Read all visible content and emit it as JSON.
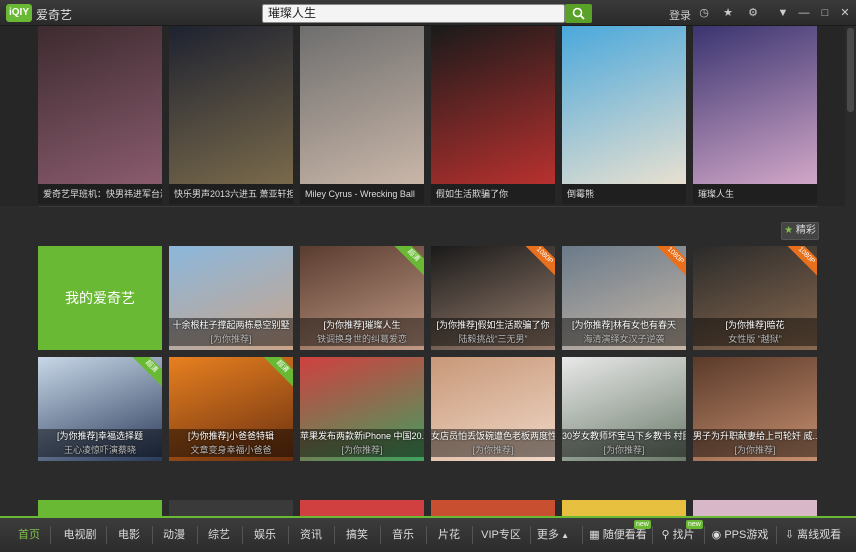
{
  "titlebar": {
    "logo": "iQIY",
    "app_name": "爱奇艺",
    "search_value": "璀璨人生",
    "login_label": "登录",
    "icons": [
      "history-icon",
      "favorite-icon",
      "skin-icon",
      "menu-icon",
      "minimize-icon",
      "maximize-icon",
      "close-icon"
    ]
  },
  "banner": [
    {
      "caption": "爱奇艺早班机：快男祎进军台湾",
      "colors": [
        "#3d2b2f",
        "#8a5b6e"
      ]
    },
    {
      "caption": "快乐男声2013六进五 萧亚轩担",
      "colors": [
        "#1e2230",
        "#7a6a4b"
      ]
    },
    {
      "caption": "Miley Cyrus - Wrecking Ball",
      "colors": [
        "#6e6e6e",
        "#c9b6a8"
      ]
    },
    {
      "caption": "假如生活欺骗了你",
      "colors": [
        "#1a1a1a",
        "#b8312f"
      ]
    },
    {
      "caption": "倒霉熊",
      "colors": [
        "#4aa8dc",
        "#e8e0d0"
      ]
    },
    {
      "caption": "璀璨人生",
      "colors": [
        "#3a3470",
        "#d2a7c8"
      ]
    }
  ],
  "jingcai_label": "精彩",
  "my_iqiyi": "我的爱奇艺",
  "row1": [
    {
      "t1": "十余根柱子撑起两栋悬空别墅",
      "t2": "[为你推荐]",
      "badge": "",
      "colors": [
        "#8bb7dc",
        "#c9a48a"
      ]
    },
    {
      "t1": "[为你推荐]璀璨人生",
      "t2": "铁调换身世的纠葛爱恋",
      "badge": "超清",
      "colors": [
        "#5a3c30",
        "#c09a85"
      ]
    },
    {
      "t1": "[为你推荐]假如生活欺骗了你",
      "t2": "陆毅挑战“三无男”",
      "badge": "1080P",
      "colors": [
        "#1a1a1a",
        "#9a8070"
      ]
    },
    {
      "t1": "[为你推荐]林有女也有春天",
      "t2": "海清演绎女汉子逆袭",
      "badge": "1080P",
      "colors": [
        "#6a7a8a",
        "#c8b8a8"
      ]
    },
    {
      "t1": "[为你推荐]暗花",
      "t2": "女性版 “越狱”",
      "badge": "1080P",
      "colors": [
        "#2a2a2a",
        "#8a6a50"
      ]
    }
  ],
  "row2": [
    {
      "t1": "[为你推荐]幸福选择题",
      "t2": "王心凌惊吓演蔡晓",
      "badge": "超清",
      "colors": [
        "#c8d8e8",
        "#2a3a5a"
      ]
    },
    {
      "t1": "[为你推荐]小爸爸特辑",
      "t2": "文章变身幸福小爸爸",
      "badge": "超清",
      "colors": [
        "#e88020",
        "#6a3010"
      ]
    },
    {
      "t1": "苹果发布两款新iPhone 中国20...",
      "t2": "[为你推荐]",
      "badge": "",
      "colors": [
        "#d04040",
        "#40a060"
      ]
    },
    {
      "t1": "女店员怕丢饭碗遭色老板两度性侵",
      "t2": "[为你推荐]",
      "badge": "",
      "colors": [
        "#c89878",
        "#f0d8c8"
      ]
    },
    {
      "t1": "30岁女教师坏宝马下乡教书 村民...",
      "t2": "[为你推荐]",
      "badge": "",
      "colors": [
        "#e8e8e8",
        "#6a7a6a"
      ]
    },
    {
      "t1": "男子为升职献妻给上司轮奸 威...",
      "t2": "[为你推荐]",
      "badge": "",
      "colors": [
        "#5a3a2a",
        "#c89070"
      ]
    }
  ],
  "bottom_nav": [
    {
      "label": "首页",
      "active": true
    },
    {
      "label": "电视剧"
    },
    {
      "label": "电影"
    },
    {
      "label": "动漫"
    },
    {
      "label": "综艺"
    },
    {
      "label": "娱乐"
    },
    {
      "label": "资讯"
    },
    {
      "label": "搞笑"
    },
    {
      "label": "音乐"
    },
    {
      "label": "片花"
    },
    {
      "label": "VIP专区"
    },
    {
      "label": "更多"
    }
  ],
  "bottom_tools": [
    {
      "label": "随便看看",
      "new": "new"
    },
    {
      "label": "找片",
      "new": "new"
    },
    {
      "label": "PPS游戏"
    },
    {
      "label": "离线观看"
    }
  ],
  "accent_color": "#6ab934"
}
